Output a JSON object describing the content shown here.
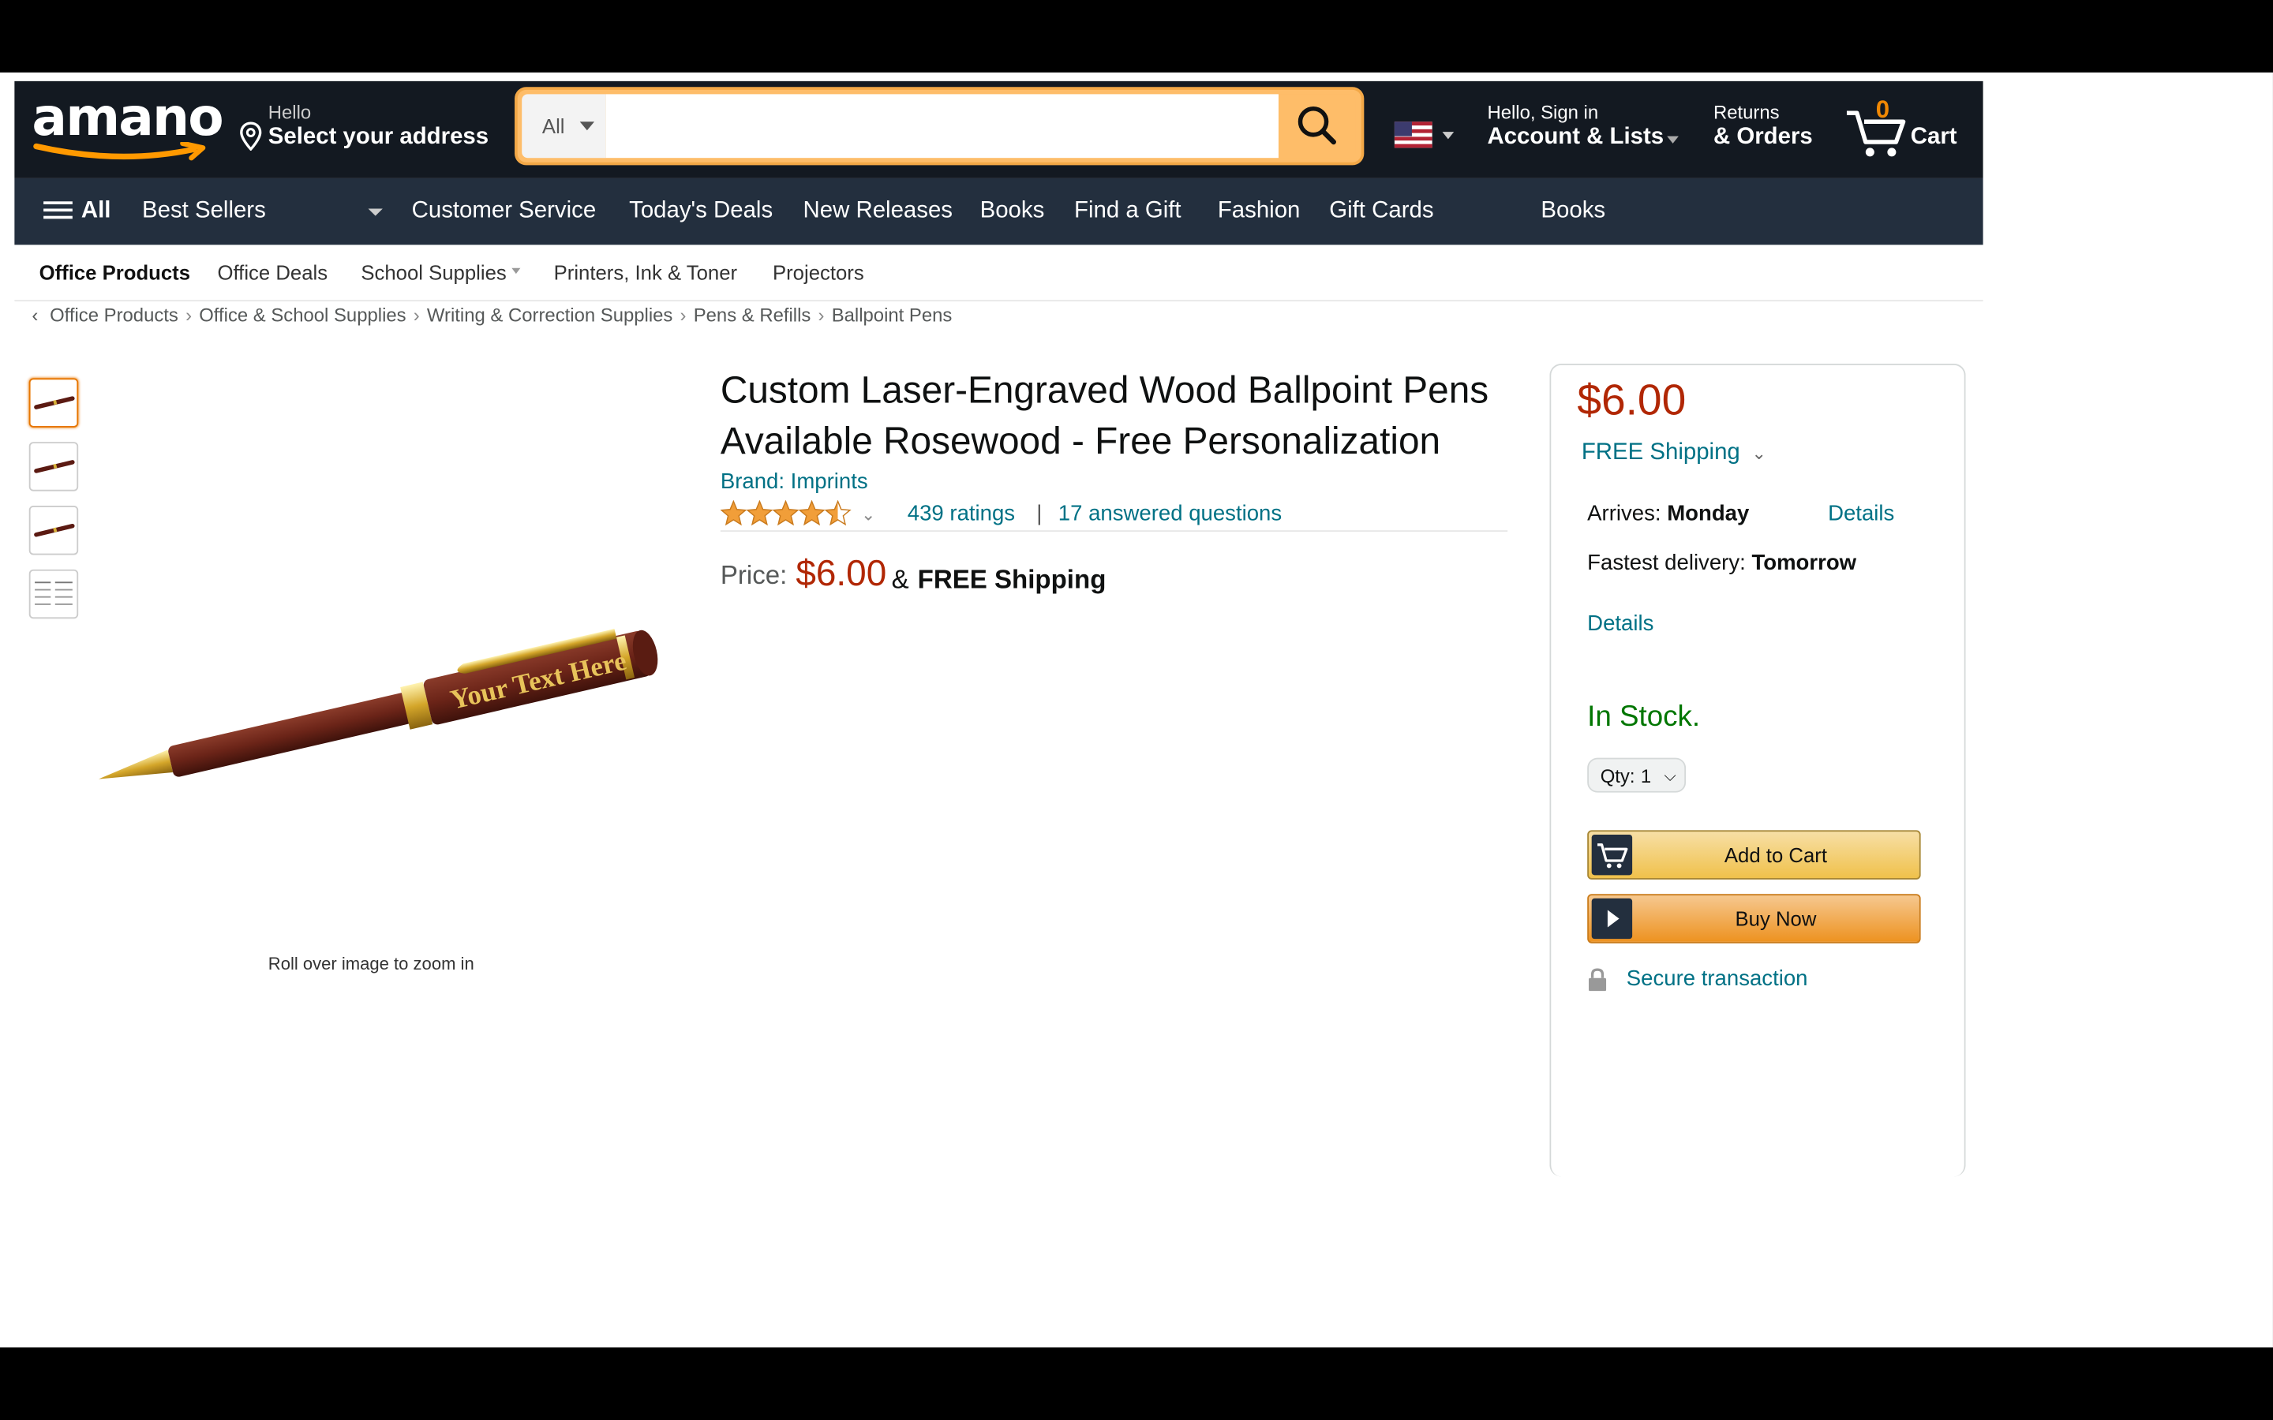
{
  "header": {
    "logo": "amano",
    "address": {
      "line1": "Hello",
      "line2": "Select your address"
    },
    "search": {
      "category": "All",
      "placeholder": "",
      "value": ""
    },
    "account": {
      "line1": "Hello, Sign in",
      "line2": "Account & Lists"
    },
    "orders": {
      "line1": "Returns",
      "line2": "& Orders"
    },
    "cart": {
      "count": "0",
      "label": "Cart"
    }
  },
  "nav": {
    "all": "All",
    "items": [
      "Best Sellers",
      "Customer Service",
      "Today's Deals",
      "New Releases",
      "Books",
      "Find a Gift",
      "Fashion",
      "Gift Cards",
      "Books"
    ]
  },
  "subnav": [
    "Office Products",
    "Office Deals",
    "School Supplies",
    "Printers, Ink & Toner",
    "Projectors"
  ],
  "breadcrumb": [
    "Office Products",
    "Office & School Supplies",
    "Writing & Correction Supplies",
    "Pens & Refills",
    "Ballpoint Pens"
  ],
  "gallery": {
    "engraving": "Your Text Here",
    "zoom_hint": "Roll over image to zoom in"
  },
  "product": {
    "title": "Custom Laser-Engraved Wood Ballpoint Pens Available Rosewood - Free Personalization",
    "brand": "Brand: Imprints",
    "rating": 4.5,
    "ratings_count": "439 ratings",
    "separator": "|",
    "answered": "17 answered questions",
    "price_label": "Price:",
    "price": "$6.00",
    "amp": "&",
    "shipping": "FREE Shipping"
  },
  "buybox": {
    "price": "$6.00",
    "shipping": "FREE Shipping",
    "arrives_label": "Arrives:",
    "arrives_day": "Monday",
    "details": "Details",
    "fastest_label": "Fastest delivery:",
    "fastest_day": "Tomorrow",
    "details2": "Details",
    "stock": "In Stock.",
    "qty_label": "Qty:",
    "qty_value": "1",
    "add_to_cart": "Add to Cart",
    "buy_now": "Buy Now",
    "secure": "Secure transaction"
  },
  "colors": {
    "header_bg": "#131921",
    "nav_bg": "#232f3e",
    "price": "#b12704",
    "link": "#007185",
    "stock": "#007600",
    "accent": "#febd69"
  }
}
